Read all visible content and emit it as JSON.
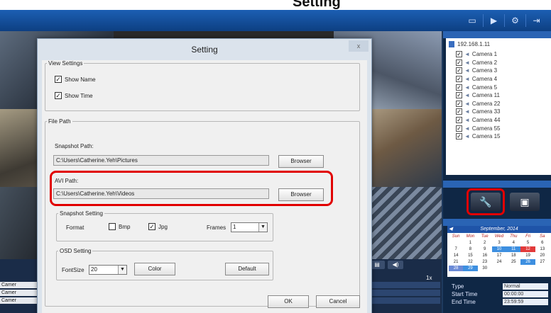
{
  "caption": {
    "text": "Setting"
  },
  "app": {
    "topbar_icons": [
      "monitor-icon",
      "playback-icon",
      "settings-icon",
      "logout-icon"
    ],
    "camera_tree": {
      "root": "192.168.1.11",
      "cameras": [
        "Camera 1",
        "Camera 2",
        "Camera 3",
        "Camera 4",
        "Camera 5",
        "Camera 11",
        "Camera 22",
        "Camera 33",
        "Camera 44",
        "Camera 55",
        "Camera 15"
      ]
    },
    "calendar": {
      "title": "September, 2014",
      "days": [
        "Sun",
        "Mon",
        "Tue",
        "Wed",
        "Thu",
        "Fri",
        "Sa"
      ],
      "rows": [
        [
          "",
          "1",
          "2",
          "3",
          "4",
          "5",
          "6"
        ],
        [
          "7",
          "8",
          "9",
          "10",
          "11",
          "12",
          "13"
        ],
        [
          "14",
          "15",
          "16",
          "17",
          "18",
          "19",
          "20"
        ],
        [
          "21",
          "22",
          "23",
          "24",
          "25",
          "26",
          "27"
        ],
        [
          "28",
          "29",
          "30",
          "",
          "",
          "",
          ""
        ]
      ]
    },
    "search": {
      "type_label": "Type",
      "type_value": "Normal",
      "start_label": "Start Time",
      "start_value": "00:00:00",
      "end_label": "End Time",
      "end_value": "23:59:59"
    },
    "speed": "1x",
    "timeline_labels": [
      "Camer",
      "Camer",
      "Camer"
    ]
  },
  "dialog": {
    "title": "Setting",
    "close": "x",
    "view_settings": {
      "legend": "View Settings",
      "show_name": "Show Name",
      "show_time": "Show Time"
    },
    "file_path": {
      "legend": "File Path",
      "snapshot_label": "Snapshot Path:",
      "snapshot_value": "C:\\Users\\Catherine.Yeh\\Pictures",
      "avi_label": "AVI Path:",
      "avi_value": "C:\\Users\\Catherine.Yeh\\Videos",
      "browser": "Browser"
    },
    "snapshot_setting": {
      "legend": "Snapshot Setting",
      "format_label": "Format",
      "bmp": "Bmp",
      "jpg": "Jpg",
      "frames_label": "Frames",
      "frames_value": "1"
    },
    "osd_setting": {
      "legend": "OSD Setting",
      "fontsize_label": "FontSize",
      "fontsize_value": "20",
      "color_button": "Color",
      "default_button": "Default"
    },
    "ok": "OK",
    "cancel": "Cancel"
  }
}
